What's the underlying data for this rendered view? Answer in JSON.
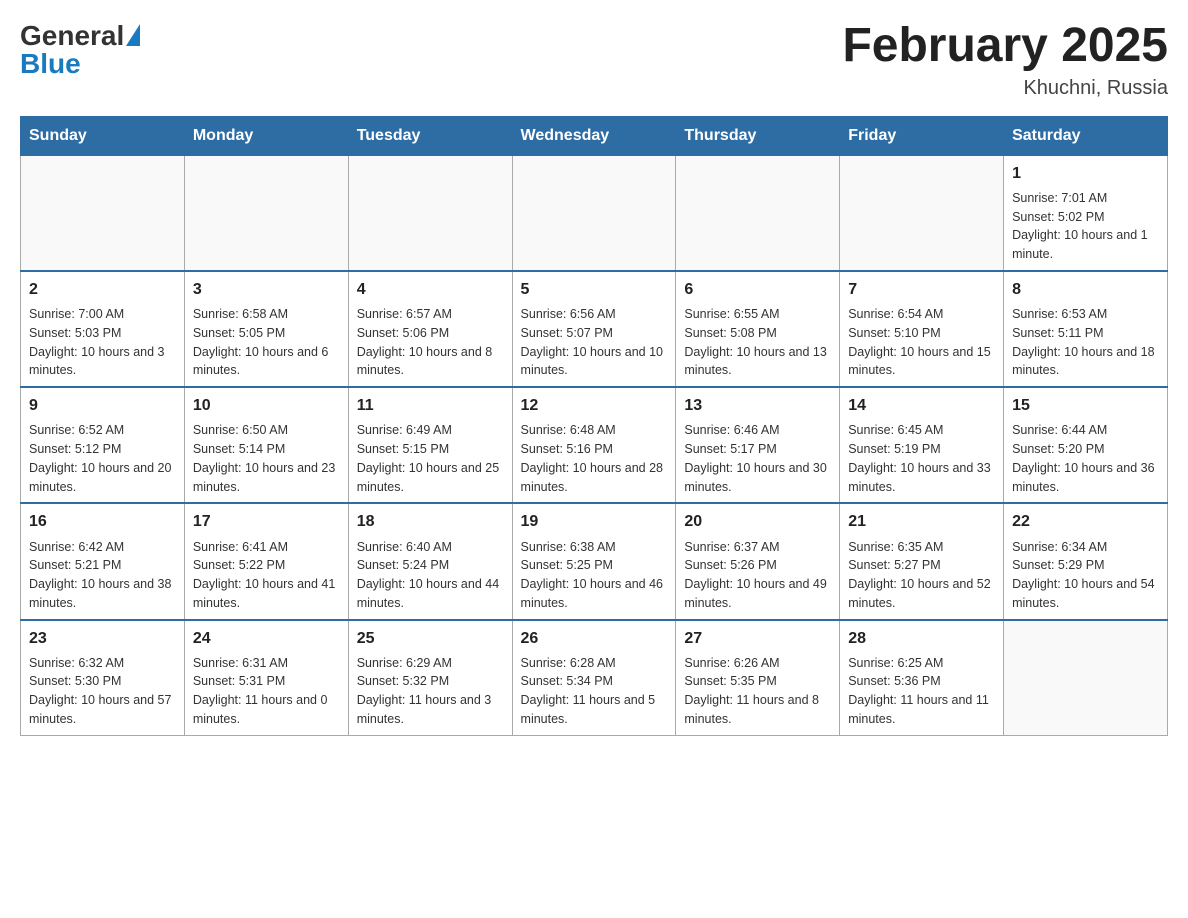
{
  "header": {
    "logo_general": "General",
    "logo_blue": "Blue",
    "title": "February 2025",
    "location": "Khuchni, Russia"
  },
  "days_of_week": [
    "Sunday",
    "Monday",
    "Tuesday",
    "Wednesday",
    "Thursday",
    "Friday",
    "Saturday"
  ],
  "weeks": [
    {
      "days": [
        {
          "number": "",
          "info": ""
        },
        {
          "number": "",
          "info": ""
        },
        {
          "number": "",
          "info": ""
        },
        {
          "number": "",
          "info": ""
        },
        {
          "number": "",
          "info": ""
        },
        {
          "number": "",
          "info": ""
        },
        {
          "number": "1",
          "info": "Sunrise: 7:01 AM\nSunset: 5:02 PM\nDaylight: 10 hours and 1 minute."
        }
      ]
    },
    {
      "days": [
        {
          "number": "2",
          "info": "Sunrise: 7:00 AM\nSunset: 5:03 PM\nDaylight: 10 hours and 3 minutes."
        },
        {
          "number": "3",
          "info": "Sunrise: 6:58 AM\nSunset: 5:05 PM\nDaylight: 10 hours and 6 minutes."
        },
        {
          "number": "4",
          "info": "Sunrise: 6:57 AM\nSunset: 5:06 PM\nDaylight: 10 hours and 8 minutes."
        },
        {
          "number": "5",
          "info": "Sunrise: 6:56 AM\nSunset: 5:07 PM\nDaylight: 10 hours and 10 minutes."
        },
        {
          "number": "6",
          "info": "Sunrise: 6:55 AM\nSunset: 5:08 PM\nDaylight: 10 hours and 13 minutes."
        },
        {
          "number": "7",
          "info": "Sunrise: 6:54 AM\nSunset: 5:10 PM\nDaylight: 10 hours and 15 minutes."
        },
        {
          "number": "8",
          "info": "Sunrise: 6:53 AM\nSunset: 5:11 PM\nDaylight: 10 hours and 18 minutes."
        }
      ]
    },
    {
      "days": [
        {
          "number": "9",
          "info": "Sunrise: 6:52 AM\nSunset: 5:12 PM\nDaylight: 10 hours and 20 minutes."
        },
        {
          "number": "10",
          "info": "Sunrise: 6:50 AM\nSunset: 5:14 PM\nDaylight: 10 hours and 23 minutes."
        },
        {
          "number": "11",
          "info": "Sunrise: 6:49 AM\nSunset: 5:15 PM\nDaylight: 10 hours and 25 minutes."
        },
        {
          "number": "12",
          "info": "Sunrise: 6:48 AM\nSunset: 5:16 PM\nDaylight: 10 hours and 28 minutes."
        },
        {
          "number": "13",
          "info": "Sunrise: 6:46 AM\nSunset: 5:17 PM\nDaylight: 10 hours and 30 minutes."
        },
        {
          "number": "14",
          "info": "Sunrise: 6:45 AM\nSunset: 5:19 PM\nDaylight: 10 hours and 33 minutes."
        },
        {
          "number": "15",
          "info": "Sunrise: 6:44 AM\nSunset: 5:20 PM\nDaylight: 10 hours and 36 minutes."
        }
      ]
    },
    {
      "days": [
        {
          "number": "16",
          "info": "Sunrise: 6:42 AM\nSunset: 5:21 PM\nDaylight: 10 hours and 38 minutes."
        },
        {
          "number": "17",
          "info": "Sunrise: 6:41 AM\nSunset: 5:22 PM\nDaylight: 10 hours and 41 minutes."
        },
        {
          "number": "18",
          "info": "Sunrise: 6:40 AM\nSunset: 5:24 PM\nDaylight: 10 hours and 44 minutes."
        },
        {
          "number": "19",
          "info": "Sunrise: 6:38 AM\nSunset: 5:25 PM\nDaylight: 10 hours and 46 minutes."
        },
        {
          "number": "20",
          "info": "Sunrise: 6:37 AM\nSunset: 5:26 PM\nDaylight: 10 hours and 49 minutes."
        },
        {
          "number": "21",
          "info": "Sunrise: 6:35 AM\nSunset: 5:27 PM\nDaylight: 10 hours and 52 minutes."
        },
        {
          "number": "22",
          "info": "Sunrise: 6:34 AM\nSunset: 5:29 PM\nDaylight: 10 hours and 54 minutes."
        }
      ]
    },
    {
      "days": [
        {
          "number": "23",
          "info": "Sunrise: 6:32 AM\nSunset: 5:30 PM\nDaylight: 10 hours and 57 minutes."
        },
        {
          "number": "24",
          "info": "Sunrise: 6:31 AM\nSunset: 5:31 PM\nDaylight: 11 hours and 0 minutes."
        },
        {
          "number": "25",
          "info": "Sunrise: 6:29 AM\nSunset: 5:32 PM\nDaylight: 11 hours and 3 minutes."
        },
        {
          "number": "26",
          "info": "Sunrise: 6:28 AM\nSunset: 5:34 PM\nDaylight: 11 hours and 5 minutes."
        },
        {
          "number": "27",
          "info": "Sunrise: 6:26 AM\nSunset: 5:35 PM\nDaylight: 11 hours and 8 minutes."
        },
        {
          "number": "28",
          "info": "Sunrise: 6:25 AM\nSunset: 5:36 PM\nDaylight: 11 hours and 11 minutes."
        },
        {
          "number": "",
          "info": ""
        }
      ]
    }
  ]
}
